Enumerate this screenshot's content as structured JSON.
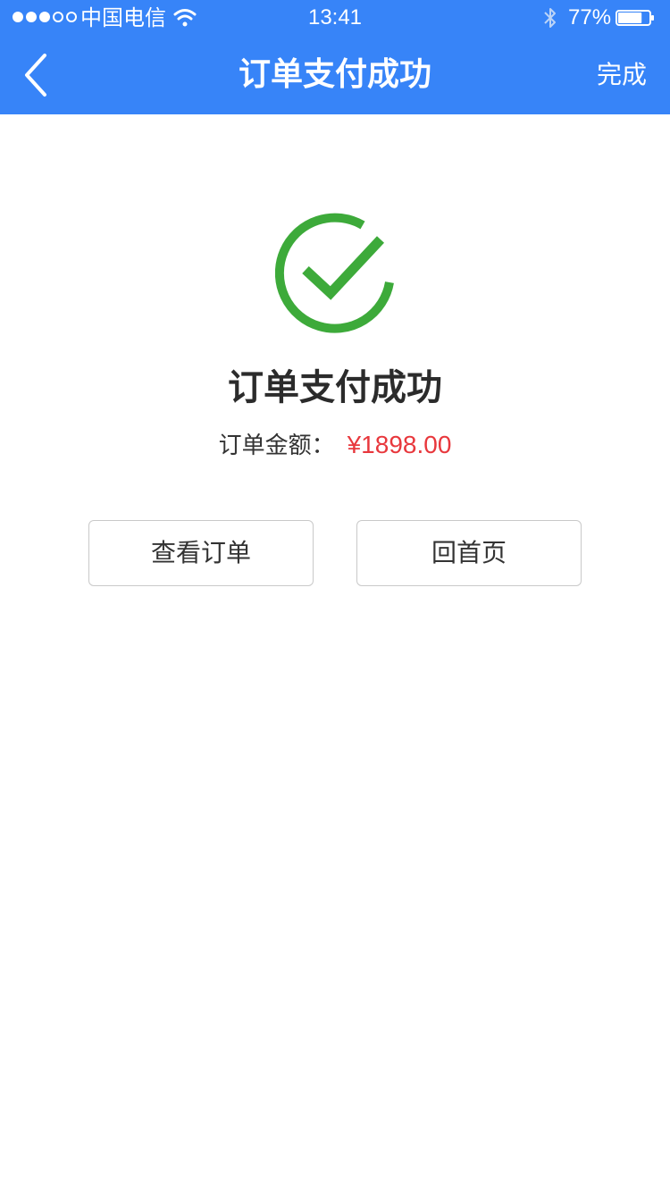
{
  "status_bar": {
    "carrier": "中国电信",
    "time": "13:41",
    "battery_percent": "77%",
    "battery_level": 0.77,
    "signal_bars_filled": 3,
    "signal_bars_total": 5
  },
  "nav": {
    "title": "订单支付成功",
    "done_label": "完成",
    "back_icon": "chevron-left-icon"
  },
  "result": {
    "icon": "success-check-icon",
    "title": "订单支付成功",
    "amount_label": "订单金额：",
    "amount_value": "¥1898.00"
  },
  "actions": {
    "view_order_label": "查看订单",
    "home_label": "回首页"
  },
  "colors": {
    "header_bg": "#3784f8",
    "success_green": "#3daa3a",
    "amount_red": "#e8383d"
  }
}
